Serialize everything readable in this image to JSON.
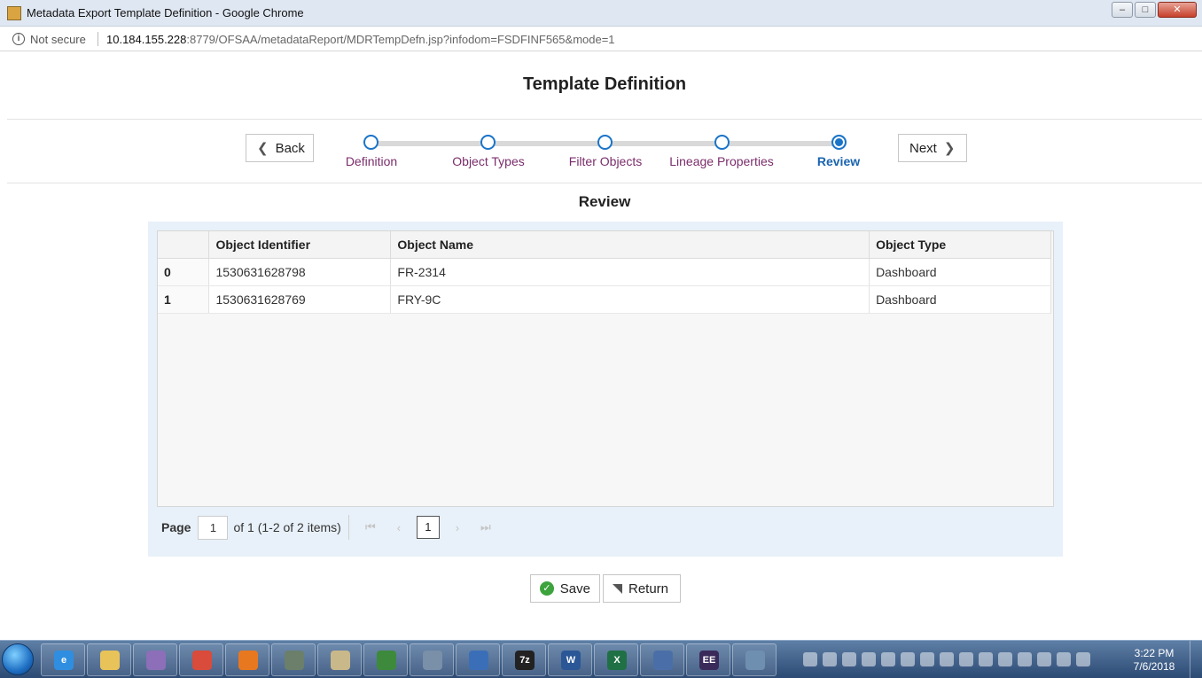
{
  "window": {
    "title": "Metadata Export Template Definition - Google Chrome",
    "controls": {
      "minimize": "–",
      "maximize": "□",
      "close": "✕"
    }
  },
  "address_bar": {
    "security_label": "Not secure",
    "url_host": "10.184.155.228",
    "url_rest": ":8779/OFSAA/metadataReport/MDRTempDefn.jsp?infodom=FSDFINF565&mode=1"
  },
  "page": {
    "title": "Template Definition",
    "back_label": "Back",
    "next_label": "Next",
    "steps": [
      {
        "label": "Definition",
        "state": "pending"
      },
      {
        "label": "Object Types",
        "state": "pending"
      },
      {
        "label": "Filter Objects",
        "state": "pending"
      },
      {
        "label": "Lineage Properties",
        "state": "pending"
      },
      {
        "label": "Review",
        "state": "active"
      }
    ],
    "section_title": "Review"
  },
  "table": {
    "columns": [
      "",
      "Object Identifier",
      "Object Name",
      "Object Type"
    ],
    "rows": [
      {
        "index": "0",
        "identifier": "1530631628798",
        "name": "FR-2314",
        "type": "Dashboard"
      },
      {
        "index": "1",
        "identifier": "1530631628769",
        "name": "FRY-9C",
        "type": "Dashboard"
      }
    ]
  },
  "pager": {
    "label": "Page",
    "current": "1",
    "total_text": "of 1 (1-2 of 2 items)",
    "first": "⏮",
    "prev": "‹",
    "page_button": "1",
    "next": "›",
    "last": "⏭"
  },
  "actions": {
    "save_label": "Save",
    "return_label": "Return"
  },
  "taskbar": {
    "clock_time": "3:22 PM",
    "clock_date": "7/6/2018",
    "apps": [
      {
        "name": "internet-explorer-icon",
        "color": "#2f8ee0",
        "glyph": "e"
      },
      {
        "name": "file-explorer-icon",
        "color": "#e8c35a",
        "glyph": ""
      },
      {
        "name": "pidgin-icon",
        "color": "#8c6fb8",
        "glyph": ""
      },
      {
        "name": "chrome-icon",
        "color": "#d94b3a",
        "glyph": ""
      },
      {
        "name": "firefox-icon",
        "color": "#e8781f",
        "glyph": ""
      },
      {
        "name": "keepass-icon",
        "color": "#6b7f6b",
        "glyph": ""
      },
      {
        "name": "notepad-icon",
        "color": "#c9b88a",
        "glyph": ""
      },
      {
        "name": "db-tool-icon",
        "color": "#3d8a3d",
        "glyph": ""
      },
      {
        "name": "remote-icon",
        "color": "#7a8fa8",
        "glyph": ""
      },
      {
        "name": "dropbox-icon",
        "color": "#3a6fb8",
        "glyph": ""
      },
      {
        "name": "7zip-icon",
        "color": "#222222",
        "glyph": "7z"
      },
      {
        "name": "word-icon",
        "color": "#2b5797",
        "glyph": "W"
      },
      {
        "name": "excel-icon",
        "color": "#1f7044",
        "glyph": "X"
      },
      {
        "name": "network-icon",
        "color": "#4a6fa8",
        "glyph": ""
      },
      {
        "name": "java-ee-ide-icon",
        "color": "#3a2a5a",
        "glyph": "EE"
      },
      {
        "name": "remote-desktop-icon",
        "color": "#6f8fb0",
        "glyph": ""
      }
    ]
  }
}
